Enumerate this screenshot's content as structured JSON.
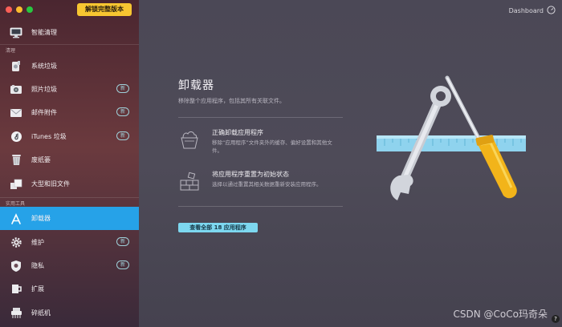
{
  "window": {
    "unlock_label": "解锁完整版本",
    "dashboard_label": "Dashboard"
  },
  "sidebar": {
    "smart_clean": "智能清理",
    "section_clean": "清理",
    "clean_items": [
      {
        "label": "系统垃圾",
        "icon": "system-junk-icon",
        "badge": ""
      },
      {
        "label": "照片垃圾",
        "icon": "photo-junk-icon",
        "badge": "新"
      },
      {
        "label": "邮件附件",
        "icon": "mail-icon",
        "badge": "新"
      },
      {
        "label": "iTunes 垃圾",
        "icon": "music-note-icon",
        "badge": "新"
      },
      {
        "label": "废纸篓",
        "icon": "trash-icon",
        "badge": ""
      },
      {
        "label": "大型和旧文件",
        "icon": "file-boxes-icon",
        "badge": ""
      }
    ],
    "section_tools": "实用工具",
    "tool_items": [
      {
        "label": "卸载器",
        "icon": "app-store-icon",
        "badge": "",
        "active": true
      },
      {
        "label": "维护",
        "icon": "gear-icon",
        "badge": "新"
      },
      {
        "label": "隐私",
        "icon": "shield-icon",
        "badge": "新"
      },
      {
        "label": "扩展",
        "icon": "extension-icon",
        "badge": ""
      },
      {
        "label": "碎纸机",
        "icon": "shredder-icon",
        "badge": ""
      }
    ]
  },
  "main": {
    "title": "卸载器",
    "subtitle": "移除整个应用程序，包括其所有关联文件。",
    "features": [
      {
        "title": "正确卸载应用程序",
        "desc": "移除“应用程序”文件夹外的缓存、偏好设置和其他文件。",
        "icon": "basket-icon"
      },
      {
        "title": "将应用程序重置为初始状态",
        "desc": "选择以通过重置其相关数据重新安装应用程序。",
        "icon": "bricks-icon"
      }
    ],
    "view_all_label": "查看全部 18 应用程序",
    "watermark": "CSDN @CoCo玛奇朵",
    "help_label": "?"
  },
  "colors": {
    "accent": "#26a2e8",
    "unlock": "#f7c631",
    "button": "#7dd8f0"
  }
}
